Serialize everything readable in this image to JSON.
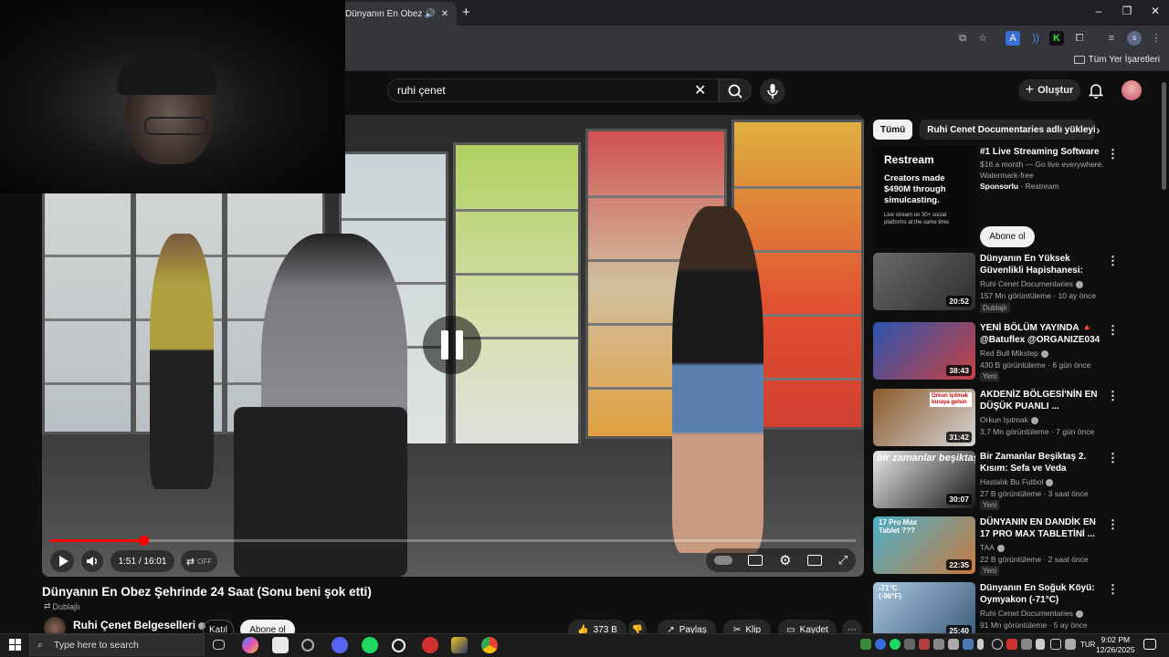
{
  "browser": {
    "tab_title": "Dünyanın En Obez Şehrinde",
    "tab_audio_icon": "speaker-icon",
    "new_tab_label": "+",
    "window_controls": [
      "–",
      "❐",
      "✕"
    ],
    "bookmarks_label": "Tüm Yer İşaretleri"
  },
  "youtube": {
    "search_value": "ruhi çenet",
    "create_label": "Oluştur",
    "video": {
      "title": "Dünyanın En Obez Şehrinde 24 Saat (Sonu beni şok etti)",
      "dub_label": "Dublajlı",
      "time": "1:51 / 16:01",
      "progress_fraction": 0.1154,
      "autodub_label": "OFF",
      "state": "paused"
    },
    "channel": {
      "name": "Ruhi Çenet Belgeselleri",
      "join_label": "Katıl",
      "subscribe_label": "Abone ol"
    },
    "actions": {
      "likes": "373 B",
      "share": "Paylaş",
      "clip": "Klip",
      "save": "Kaydet"
    },
    "chips": [
      "Tümü",
      "Ruhi Cenet Documentaries adlı yükleyiciden"
    ],
    "ad": {
      "brand": "Restream",
      "body": "Creators made $490M through simulcasting.",
      "small": "Live stream on 30+ social platforms at the same time.",
      "title": "#1 Live Streaming Software",
      "line1": "$16 a month — Go live everywhere.",
      "line2": "Watermark-free",
      "sponsored": "Sponsorlu",
      "advertiser": "· Restream",
      "cta": "Abone ol"
    },
    "recommendations": [
      {
        "title": "Dünyanın En Yüksek Güvenlikli Hapishanesi: CECOT (Şeytanla...",
        "channel": "Ruhi Cenet Documentaries",
        "meta": "157 Mn görüntüleme · 10 ay önce",
        "badge": "Dublajlı",
        "duration": "20:52",
        "color_a": "#6a6a6a",
        "color_b": "#2c2c2c"
      },
      {
        "title": "YENİ BÖLÜM YAYINDA 🔺 @Batuflex @ORGANIZE034 ...",
        "channel": "Red Bull Mikstep",
        "meta": "430 B görüntüleme · 6 gün önce",
        "badge": "Yeni",
        "duration": "38:43",
        "color_a": "#2a55b0",
        "color_b": "#c84040"
      },
      {
        "title": "AKDENİZ BÖLGESİ'NİN EN DÜŞÜK PUANLI ...",
        "channel": "Orkun Işıtmak",
        "meta": "3,7 Mn görüntüleme · 7 gün önce",
        "badge": "",
        "duration": "31:42",
        "color_a": "#8a5a2a",
        "color_b": "#d6d6d6"
      },
      {
        "title": "Bir Zamanlar Beşiktaş 2. Kısım: Sefa ve Veda",
        "channel": "Hastalık Bu Futbol",
        "meta": "27 B görüntüleme · 3 saat önce",
        "badge": "Yeni",
        "duration": "30:07",
        "color_a": "#e8e8e8",
        "color_b": "#1a1a1a"
      },
      {
        "title": "DÜNYANIN EN DANDİK EN 17 PRO MAX TABLETİNİ ...",
        "channel": "TAA",
        "meta": "22 B görüntüleme · 2 saat önce",
        "badge": "Yeni",
        "duration": "22:35",
        "color_a": "#4ab0c8",
        "color_b": "#c87a40"
      },
      {
        "title": "Dünyanın En Soğuk Köyü: Oymyakon (-71°C)",
        "channel": "Ruhi Cenet Documentaries",
        "meta": "91 Mn görüntüleme · 5 ay önce",
        "badge": "",
        "duration": "25:40",
        "color_a": "#a8c8e0",
        "color_b": "#3a5a7a"
      }
    ]
  },
  "taskbar": {
    "search_placeholder": "Type here to search",
    "language": "TUR",
    "time": "9:02 PM",
    "date": "12/26/2025"
  },
  "overlay_thumb_labels": {
    "rec3": "bir zamanlar beşiktaş",
    "rec4": "17 Pro Max Tablet ???",
    "rec5": "-71°C (-96°F)",
    "rec2": "Orkun Işıtmak buraya gelsin"
  }
}
